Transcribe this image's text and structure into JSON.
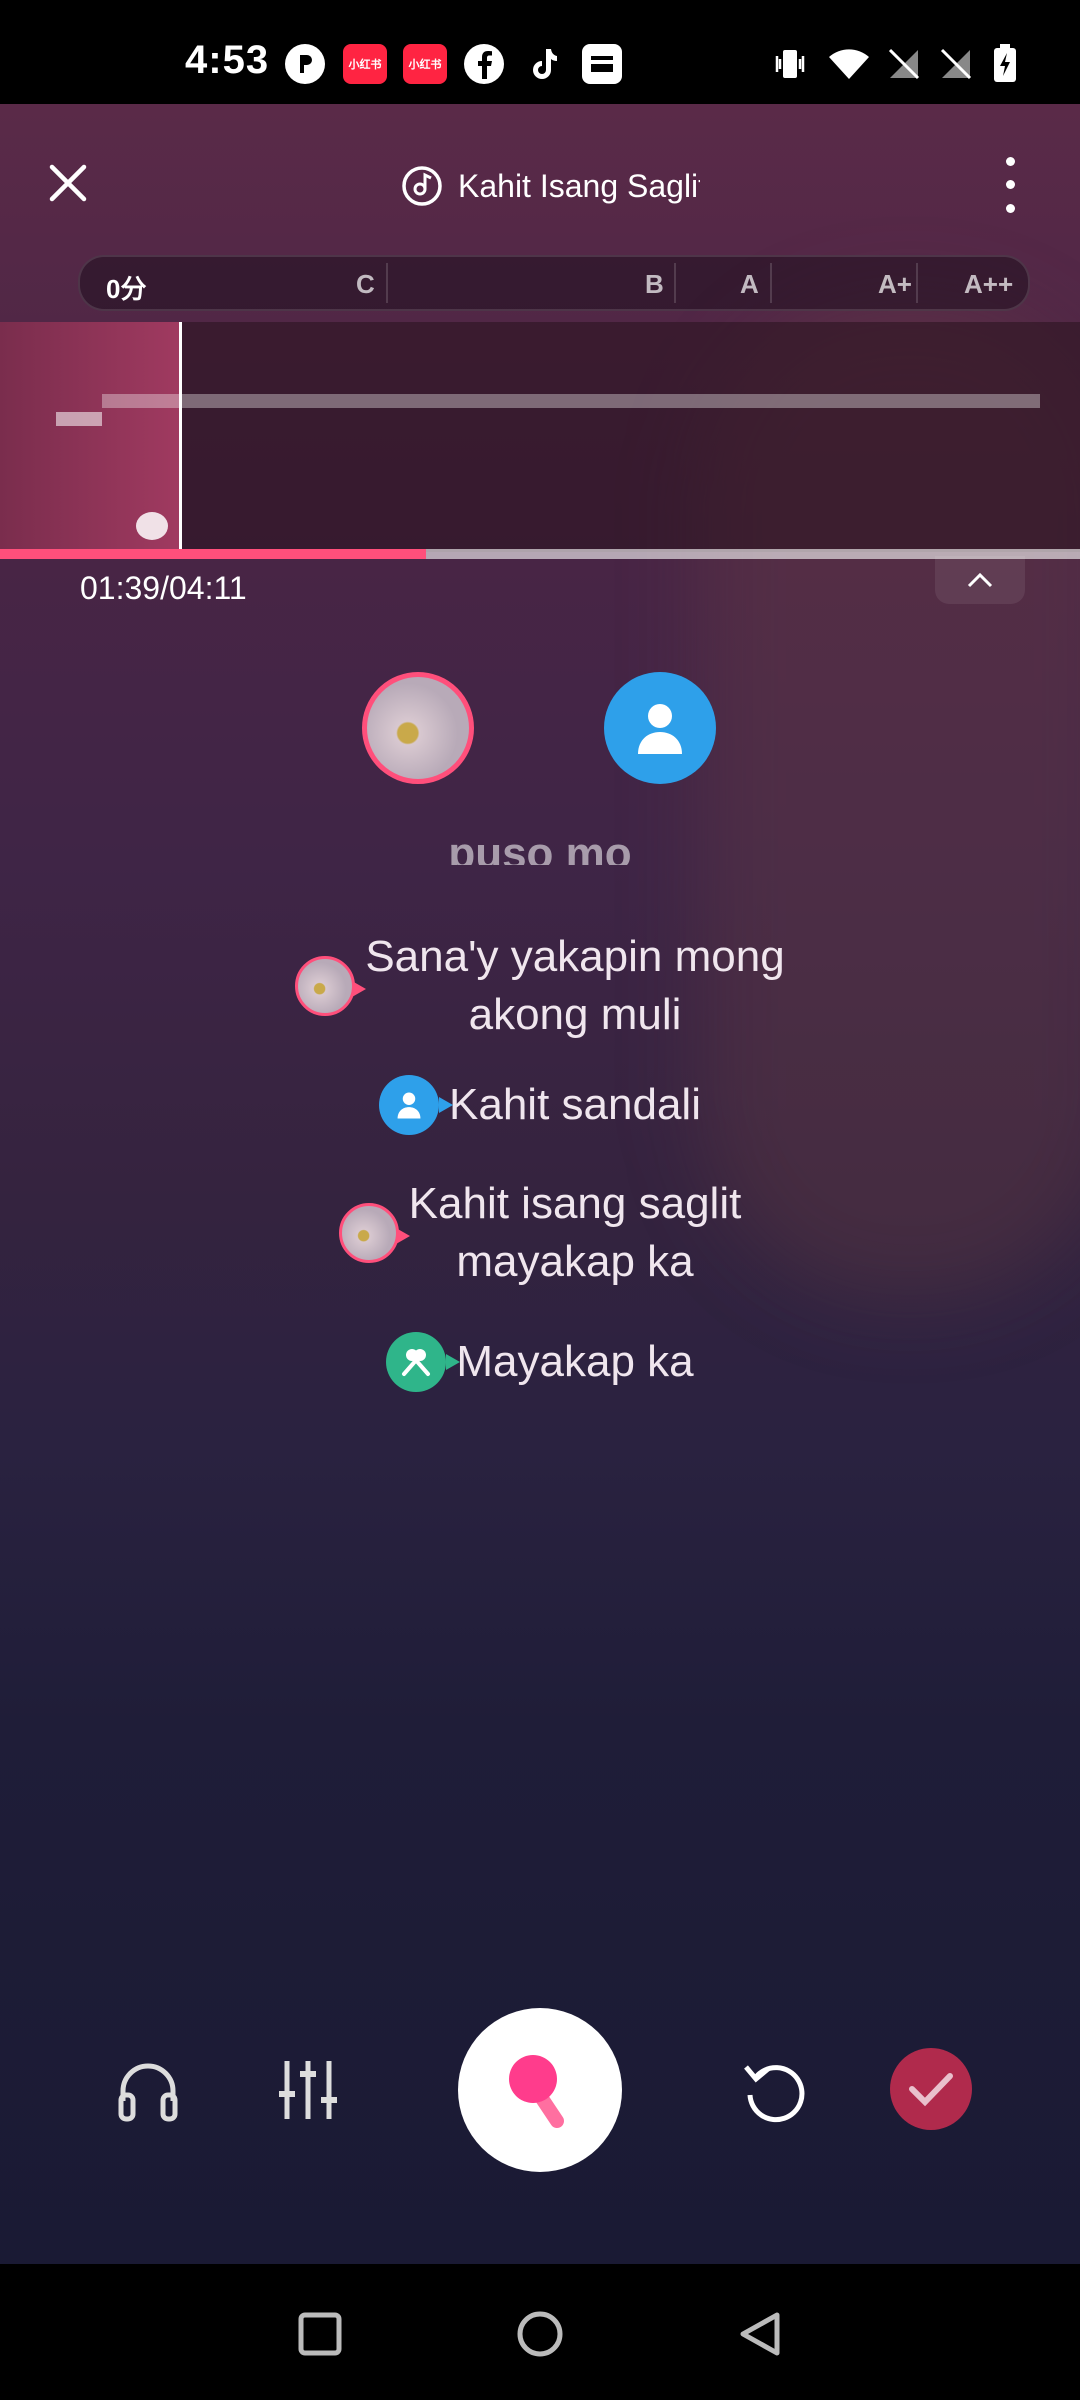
{
  "status_bar": {
    "time": "4:53",
    "icons": [
      "p-icon",
      "xiaohongshu-icon",
      "xiaohongshu-icon",
      "facebook-icon",
      "tiktok-icon",
      "wallet-icon",
      "vibrate-icon",
      "wifi-icon",
      "no-signal-icon",
      "no-signal-icon",
      "battery-charging-icon"
    ],
    "xhs_label": "小红书"
  },
  "header": {
    "song_title": "Kahit Isang Saglit"
  },
  "score_bar": {
    "current": "0分",
    "grades": [
      "C",
      "B",
      "A",
      "A+",
      "A++"
    ]
  },
  "playback": {
    "time": "01:39/04:11",
    "progress": 0.394
  },
  "lyrics": {
    "previous_fragment": "puso mo",
    "lines": [
      {
        "singer": "pink",
        "text": "Sana'y yakapin mong\nakong muli"
      },
      {
        "singer": "blue",
        "text": "Kahit sandali"
      },
      {
        "singer": "pink",
        "text": "Kahit isang saglit\nmayakap ka"
      },
      {
        "singer": "green",
        "text": "Mayakap ka"
      }
    ]
  },
  "colors": {
    "accent": "#ff4f7b",
    "singer_blue": "#2ea0ea",
    "chorus_green": "#2fb58a",
    "finish": "#b02a4c"
  }
}
